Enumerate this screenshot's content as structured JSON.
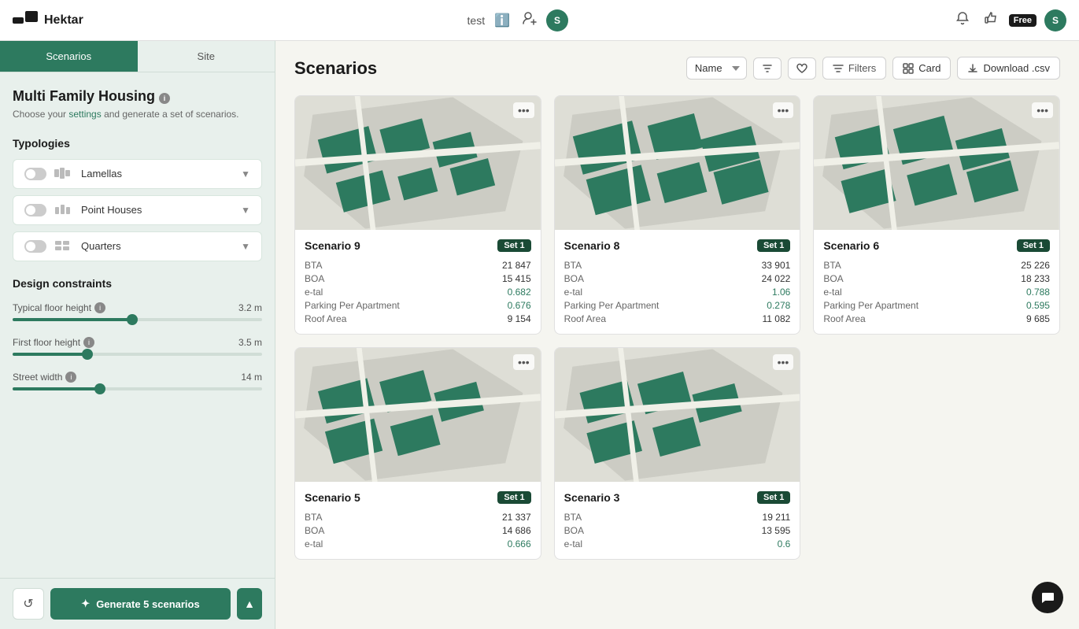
{
  "app": {
    "name": "Hektar"
  },
  "topnav": {
    "project_name": "test",
    "info_icon": "ℹ",
    "add_user_icon": "👤+",
    "user_avatar": "S",
    "notification_icon": "🔔",
    "like_icon": "👍",
    "free_badge": "Free",
    "user_avatar2": "S"
  },
  "sidebar": {
    "tab_scenarios": "Scenarios",
    "tab_site": "Site",
    "project_title": "Multi Family Housing",
    "project_subtitle": "Choose your settings and generate a set of scenarios.",
    "section_typologies": "Typologies",
    "typologies": [
      {
        "name": "Lamellas",
        "icon": "▦"
      },
      {
        "name": "Point Houses",
        "icon": "⊞"
      },
      {
        "name": "Quarters",
        "icon": "◫"
      }
    ],
    "section_design_constraints": "Design constraints",
    "constraints": [
      {
        "label": "Typical floor height",
        "value": "3.2 m",
        "fill_pct": 48
      },
      {
        "label": "First floor height",
        "value": "3.5 m",
        "fill_pct": 30
      },
      {
        "label": "Street width",
        "value": "14 m",
        "fill_pct": 35
      }
    ],
    "generate_btn": "Generate 5 scenarios",
    "history_icon": "↺",
    "expand_icon": "▲"
  },
  "main": {
    "title": "Scenarios",
    "sort_label": "Name",
    "filters_label": "Filters",
    "card_label": "Card",
    "download_label": "Download .csv",
    "scenarios": [
      {
        "name": "Scenario 9",
        "set": "Set 1",
        "stats": [
          {
            "label": "BTA",
            "value": "21 847",
            "highlight": false
          },
          {
            "label": "BOA",
            "value": "15 415",
            "highlight": false
          },
          {
            "label": "e-tal",
            "value": "0.682",
            "highlight": true
          },
          {
            "label": "Parking Per Apartment",
            "value": "0.676",
            "highlight": true
          },
          {
            "label": "Roof Area",
            "value": "9 154",
            "highlight": false
          }
        ]
      },
      {
        "name": "Scenario 8",
        "set": "Set 1",
        "stats": [
          {
            "label": "BTA",
            "value": "33 901",
            "highlight": false
          },
          {
            "label": "BOA",
            "value": "24 022",
            "highlight": false
          },
          {
            "label": "e-tal",
            "value": "1.06",
            "highlight": true
          },
          {
            "label": "Parking Per Apartment",
            "value": "0.278",
            "highlight": true
          },
          {
            "label": "Roof Area",
            "value": "11 082",
            "highlight": false
          }
        ]
      },
      {
        "name": "Scenario 6",
        "set": "Set 1",
        "stats": [
          {
            "label": "BTA",
            "value": "25 226",
            "highlight": false
          },
          {
            "label": "BOA",
            "value": "18 233",
            "highlight": false
          },
          {
            "label": "e-tal",
            "value": "0.788",
            "highlight": true
          },
          {
            "label": "Parking Per Apartment",
            "value": "0.595",
            "highlight": true
          },
          {
            "label": "Roof Area",
            "value": "9 685",
            "highlight": false
          }
        ]
      },
      {
        "name": "Scenario 5",
        "set": "Set 1",
        "stats": [
          {
            "label": "BTA",
            "value": "21 337",
            "highlight": false
          },
          {
            "label": "BOA",
            "value": "14 686",
            "highlight": false
          },
          {
            "label": "e-tal",
            "value": "0.666",
            "highlight": true
          }
        ]
      },
      {
        "name": "Scenario 3",
        "set": "Set 1",
        "stats": [
          {
            "label": "BTA",
            "value": "19 211",
            "highlight": false
          },
          {
            "label": "BOA",
            "value": "13 595",
            "highlight": false
          },
          {
            "label": "e-tal",
            "value": "0.6",
            "highlight": true
          }
        ]
      }
    ]
  }
}
